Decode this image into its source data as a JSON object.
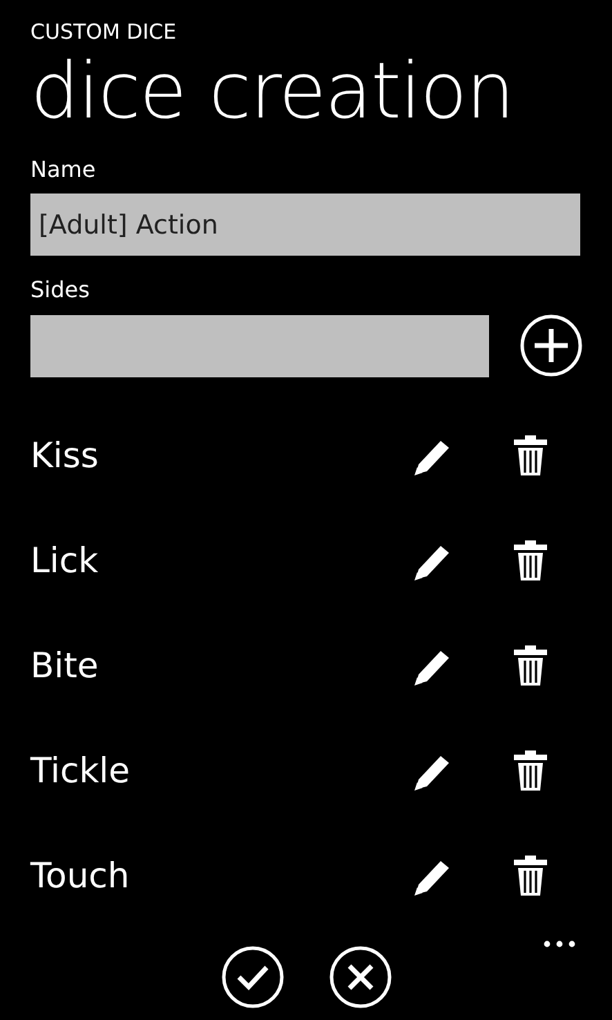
{
  "app_title": "CUSTOM DICE",
  "page_title": "dice creation",
  "name_field": {
    "label": "Name",
    "value": "[Adult] Action"
  },
  "sides_field": {
    "label": "Sides"
  },
  "sides": [
    {
      "label": "Kiss"
    },
    {
      "label": "Lick"
    },
    {
      "label": "Bite"
    },
    {
      "label": "Tickle"
    },
    {
      "label": "Touch"
    }
  ],
  "app_bar": [
    {
      "kind": "check"
    },
    {
      "kind": "cancel"
    }
  ]
}
